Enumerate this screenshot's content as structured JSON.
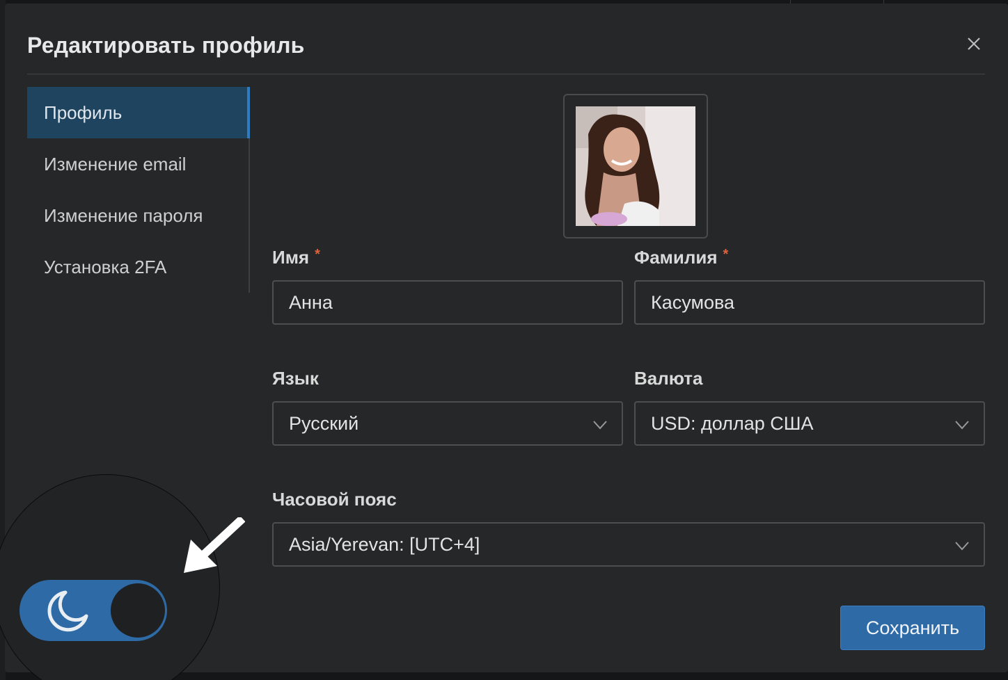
{
  "modal": {
    "title": "Редактировать профиль",
    "close_icon": "close-icon"
  },
  "sidenav": {
    "items": [
      {
        "label": "Профиль",
        "active": true
      },
      {
        "label": "Изменение email",
        "active": false
      },
      {
        "label": "Изменение пароля",
        "active": false
      },
      {
        "label": "Установка 2FA",
        "active": false
      }
    ]
  },
  "form": {
    "first_name": {
      "label": "Имя",
      "required": "*",
      "value": "Анна"
    },
    "last_name": {
      "label": "Фамилия",
      "required": "*",
      "value": "Касумова"
    },
    "language": {
      "label": "Язык",
      "value": "Русский"
    },
    "currency": {
      "label": "Валюта",
      "value": "USD: доллар США"
    },
    "timezone": {
      "label": "Часовой пояс",
      "value": "Asia/Yerevan: [UTC+4]"
    },
    "save_label": "Сохранить"
  },
  "theme_toggle": {
    "icon": "moon-icon",
    "state": "dark"
  },
  "colors": {
    "accent": "#2e6aa6",
    "active_nav_bg": "#1f4460",
    "required_mark": "#e0623c",
    "modal_bg": "#262728"
  }
}
